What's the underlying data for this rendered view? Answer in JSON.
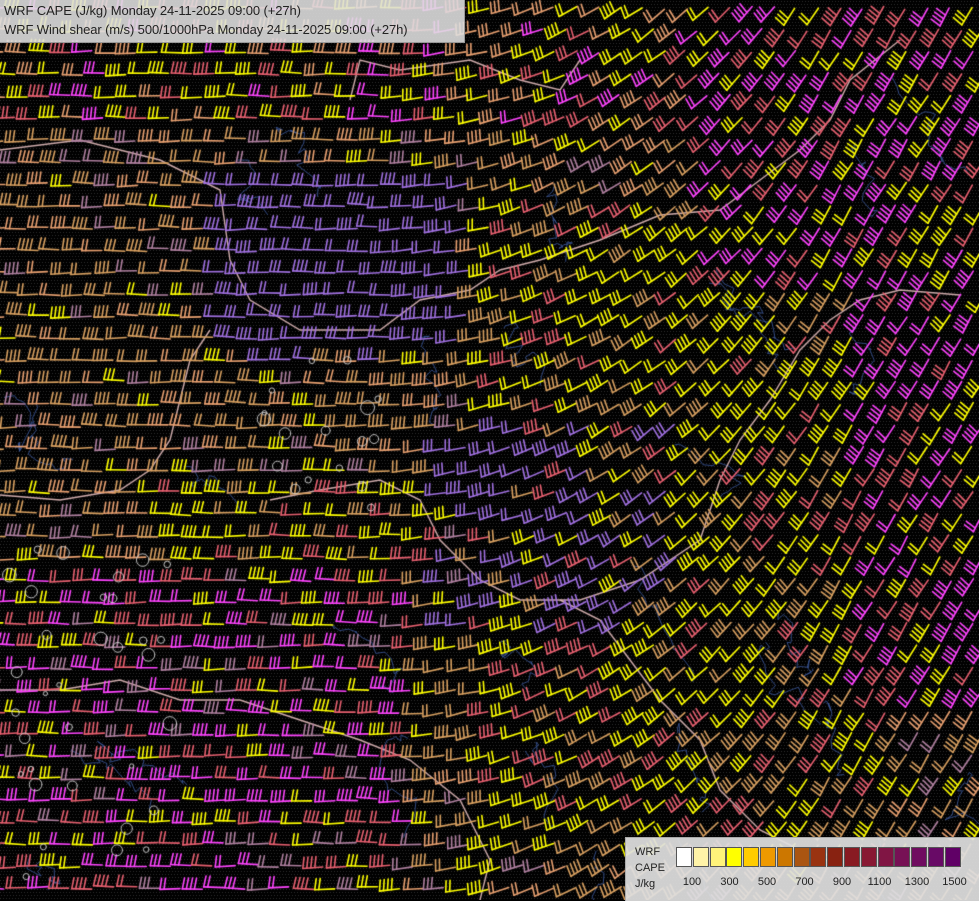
{
  "header": {
    "line1": "WRF CAPE (J/kg) Monday 24-11-2025 09:00 (+27h)",
    "line2": "WRF Wind shear (m/s) 500/1000hPa Monday 24-11-2025 09:00 (+27h)"
  },
  "legend": {
    "title1": "WRF",
    "title2": "CAPE",
    "unit": "J/kg",
    "swatch_colors": [
      "#ffffff",
      "#fff3a8",
      "#fff37a",
      "#ffff00",
      "#ffcc00",
      "#ee9900",
      "#cc7700",
      "#aa5511",
      "#993311",
      "#882211",
      "#881a22",
      "#881833",
      "#801544",
      "#771155",
      "#700c60",
      "#680a66",
      "#600066"
    ],
    "tick_labels": [
      "100",
      "300",
      "500",
      "700",
      "900",
      "1100",
      "1300",
      "1500"
    ]
  },
  "map": {
    "icons": [
      "wind-barb-field",
      "border-lines",
      "coastline-lines"
    ],
    "barb_colors": [
      "#ffff00",
      "#e8a070",
      "#d8a060",
      "#ff44ff",
      "#a070e0",
      "#e86070",
      "#b080a0"
    ]
  }
}
